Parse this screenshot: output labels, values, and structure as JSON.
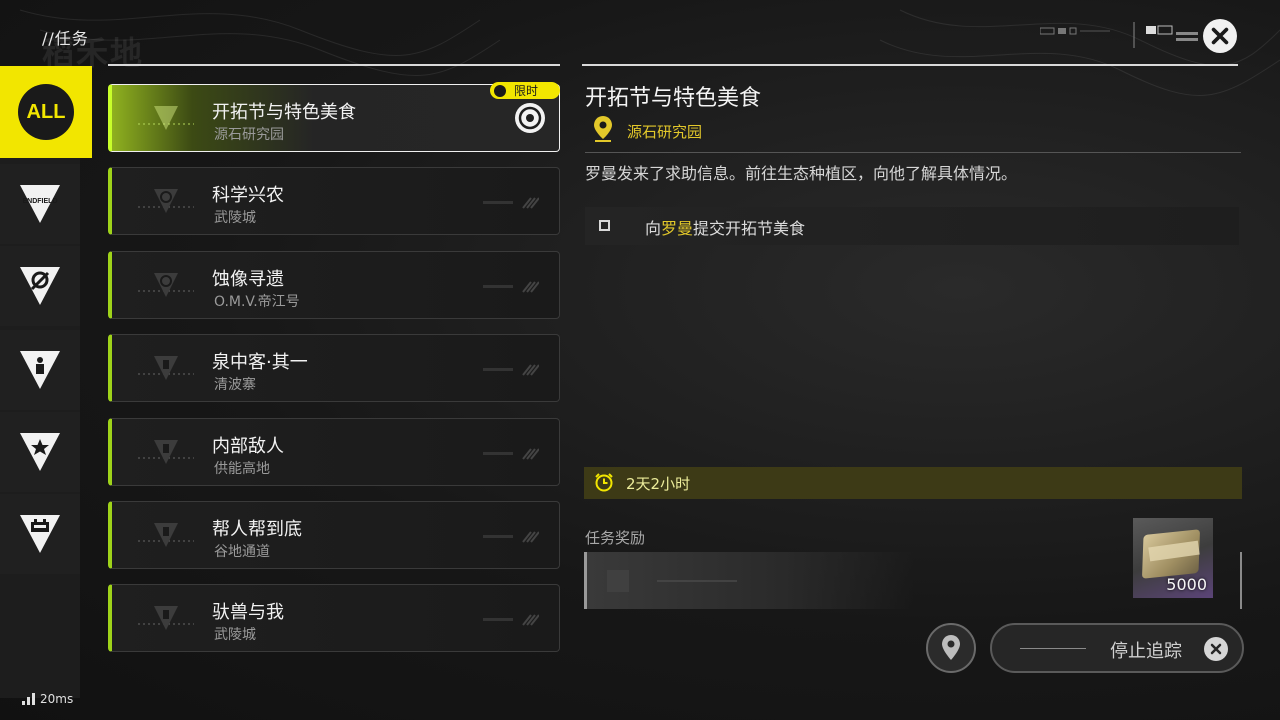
{
  "header": {
    "title": "//任务"
  },
  "sidebar": {
    "categories": [
      {
        "label": "ALL",
        "icon": "all-category-icon",
        "active": true
      },
      {
        "label": "ENDFIELD",
        "icon": "endfield-category-icon"
      },
      {
        "label": "",
        "icon": "explore-category-icon"
      },
      {
        "label": "",
        "icon": "character-category-icon"
      },
      {
        "label": "",
        "icon": "star-category-icon"
      },
      {
        "label": "",
        "icon": "facility-category-icon"
      }
    ]
  },
  "quests": [
    {
      "title": "开拓节与特色美食",
      "location": "源石研究园",
      "selected": true,
      "limited_label": "限时"
    },
    {
      "title": "科学兴农",
      "location": "武陵城"
    },
    {
      "title": "蚀像寻遗",
      "location": "O.M.V.帝江号"
    },
    {
      "title": "泉中客·其一",
      "location": "清波寨"
    },
    {
      "title": "内部敌人",
      "location": "供能高地"
    },
    {
      "title": "帮人帮到底",
      "location": "谷地通道"
    },
    {
      "title": "驮兽与我",
      "location": "武陵城"
    }
  ],
  "detail": {
    "title": "开拓节与特色美食",
    "location": "源石研究园",
    "description": "罗曼发来了求助信息。前往生态种植区，向他了解具体情况。",
    "objective": {
      "prefix": "向",
      "highlight": "罗曼",
      "suffix": "提交开拓节美食"
    },
    "time_left": "2天2小时",
    "rewards_label": "任务奖励",
    "rewards": [
      {
        "icon": "money-bundle-icon",
        "quantity": "5000",
        "rarity_color": "#5b4478"
      }
    ]
  },
  "controls": {
    "stop_tracking_label": "停止追踪"
  },
  "status": {
    "latency": "20ms"
  },
  "colors": {
    "accent_yellow": "#f2e600",
    "quest_green": "#9fd31a",
    "location_gold": "#e3c82a"
  }
}
